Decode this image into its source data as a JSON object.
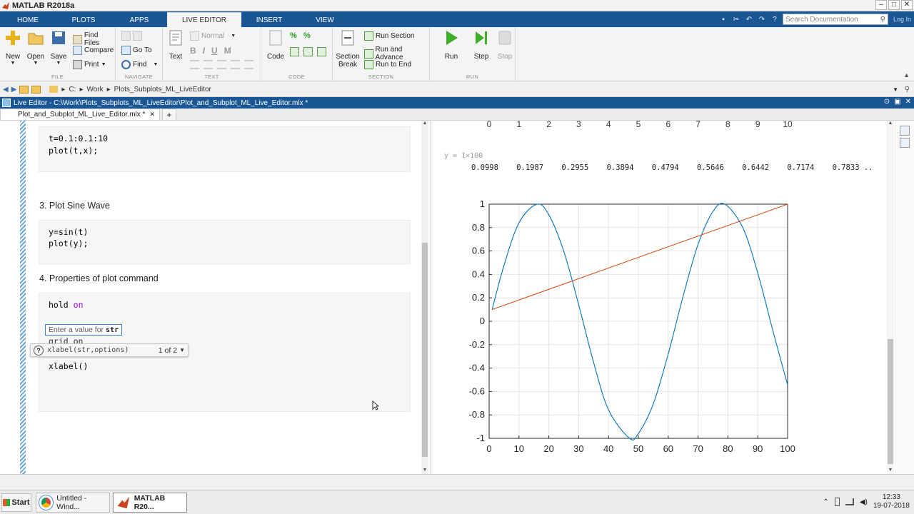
{
  "window": {
    "title": "MATLAB R2018a"
  },
  "tabs": [
    "HOME",
    "PLOTS",
    "APPS",
    "LIVE EDITOR",
    "INSERT",
    "VIEW"
  ],
  "active_tab": "LIVE EDITOR",
  "search": {
    "placeholder": "Search Documentation"
  },
  "login_label": "Log In",
  "ribbon": {
    "file": {
      "label": "FILE",
      "new": "New",
      "open": "Open",
      "save": "Save",
      "find_files": "Find Files",
      "compare": "Compare",
      "print": "Print"
    },
    "navigate": {
      "label": "NAVIGATE",
      "go_to": "Go To",
      "find": "Find"
    },
    "text": {
      "label": "TEXT",
      "text": "Text",
      "style": "Normal"
    },
    "code": {
      "label": "CODE",
      "code": "Code"
    },
    "section": {
      "label": "SECTION",
      "section_break_1": "Section",
      "section_break_2": "Break",
      "run_section": "Run Section",
      "run_and_advance": "Run and Advance",
      "run_to_end": "Run to End"
    },
    "run": {
      "label": "RUN",
      "run": "Run",
      "step": "Step",
      "stop": "Stop"
    }
  },
  "address": {
    "drive": "C:",
    "folder1": "Work",
    "folder2": "Plots_Subplots_ML_LiveEditor"
  },
  "live_editor": {
    "title": "Live Editor - C:\\Work\\Plots_Subplots_ML_LiveEditor\\Plot_and_Subplot_ML_Live_Editor.mlx *",
    "doc_tab": "Plot_and_Subplot_ML_Live_Editor.mlx *"
  },
  "editor": {
    "code1": [
      "t=0.1:0.1:10",
      "plot(t,x);"
    ],
    "heading3": "3. Plot Sine Wave",
    "code2": [
      "y=sin(t)",
      "plot(y);"
    ],
    "heading4": "4. Properties of plot command",
    "code3": {
      "hold": "hold",
      "on": "on",
      "grid_partial": "grid on",
      "xlabel": "xlabel()"
    },
    "hint": {
      "text": "Enter a value for",
      "arg": "str"
    },
    "signature": {
      "sig": "xlabel(str,options)",
      "count": "1 of 2"
    }
  },
  "output": {
    "top_ticks": [
      "0",
      "1",
      "2",
      "3",
      "4",
      "5",
      "6",
      "7",
      "8",
      "9",
      "10"
    ],
    "y_header": "y = 1×100",
    "y_values": [
      "0.0998",
      "0.1987",
      "0.2955",
      "0.3894",
      "0.4794",
      "0.5646",
      "0.6442",
      "0.7174",
      "0.7833 .."
    ]
  },
  "chart_data": {
    "type": "line",
    "title": "",
    "xlabel": "",
    "ylabel": "",
    "xlim": [
      0,
      100
    ],
    "ylim": [
      -1,
      1
    ],
    "xticks": [
      "0",
      "10",
      "20",
      "30",
      "40",
      "50",
      "60",
      "70",
      "80",
      "90",
      "100"
    ],
    "yticks": [
      "1",
      "0.8",
      "0.6",
      "0.4",
      "0.2",
      "0",
      "-0.2",
      "-0.4",
      "-0.6",
      "-0.8",
      "-1"
    ],
    "grid": true,
    "series": [
      {
        "color": "#0072bd",
        "x": [
          1,
          5,
          10,
          16,
          20,
          25,
          30,
          35,
          40,
          47,
          50,
          55,
          60,
          65,
          70,
          75,
          79,
          85,
          90,
          95,
          100
        ],
        "y": [
          0.0998,
          0.479,
          0.841,
          0.9996,
          0.909,
          0.598,
          0.141,
          -0.351,
          -0.757,
          -0.999,
          -0.959,
          -0.706,
          -0.279,
          0.215,
          0.657,
          0.938,
          0.9989,
          0.798,
          0.412,
          -0.075,
          -0.544
        ]
      },
      {
        "color": "#d95319",
        "x": [
          1,
          100
        ],
        "y": [
          0.1,
          1
        ]
      }
    ]
  },
  "taskbar": {
    "start": "Start",
    "item1": "Untitled - Wind...",
    "item2": "MATLAB R20...",
    "time": "12:33",
    "date": "19-07-2018"
  }
}
